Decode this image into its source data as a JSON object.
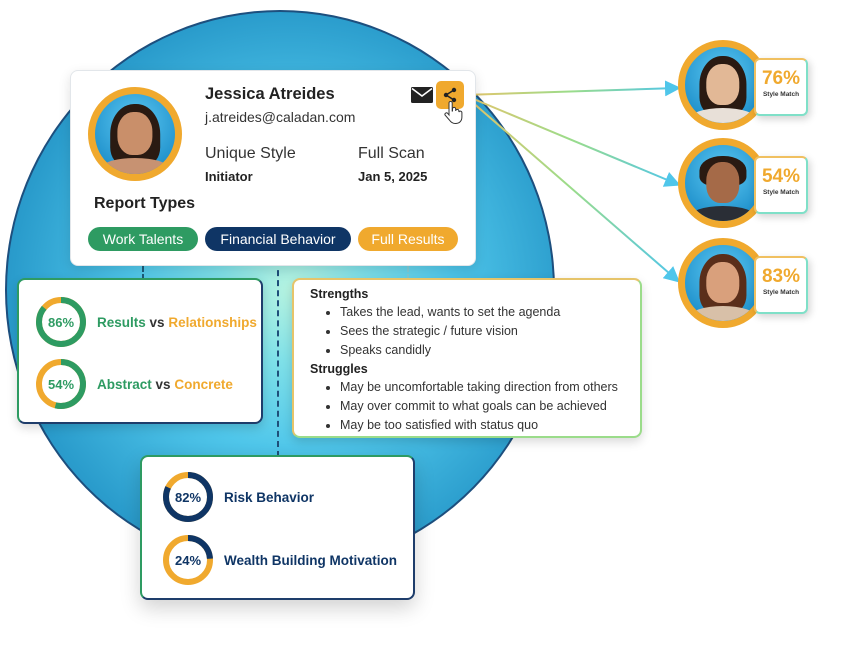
{
  "colors": {
    "green": "#2e9b62",
    "navy": "#0f3565",
    "orange": "#f0a92e",
    "teal": "#4fc6ea"
  },
  "profile": {
    "name": "Jessica Atreides",
    "email": "j.atreides@caladan.com",
    "unique_style_label": "Unique Style",
    "unique_style_value": "Initiator",
    "full_scan_label": "Full Scan",
    "full_scan_value": "Jan 5, 2025",
    "report_types_label": "Report Types",
    "icons": {
      "mail": "envelope-icon",
      "share": "share-icon",
      "cursor": "hand-pointer-icon"
    },
    "report_types": [
      {
        "label": "Work Talents",
        "color": "#2e9b62"
      },
      {
        "label": "Financial Behavior",
        "color": "#0f3565"
      },
      {
        "label": "Full Results",
        "color": "#f0a92e"
      }
    ]
  },
  "work_talents": {
    "rows": [
      {
        "percent": 86,
        "pct_label": "86%",
        "left": "Results",
        "vs": "vs",
        "right": "Relationships"
      },
      {
        "percent": 54,
        "pct_label": "54%",
        "left": "Abstract",
        "vs": "vs",
        "right": "Concrete"
      }
    ]
  },
  "full_results": {
    "strengths_title": "Strengths",
    "strengths": [
      "Takes the lead, wants to set the agenda",
      "Sees the strategic / future vision",
      "Speaks candidly"
    ],
    "struggles_title": "Struggles",
    "struggles": [
      "May be uncomfortable taking direction from others",
      "May over commit to what goals can be achieved",
      "May be too satisfied with status quo"
    ]
  },
  "financial_behavior": {
    "rows": [
      {
        "percent": 82,
        "pct_label": "82%",
        "label": "Risk Behavior"
      },
      {
        "percent": 24,
        "pct_label": "24%",
        "label": "Wealth Building Motivation"
      }
    ]
  },
  "style_matches": [
    {
      "percent": 76,
      "pct_label": "76%",
      "label": "Style Match"
    },
    {
      "percent": 54,
      "pct_label": "54%",
      "label": "Style Match"
    },
    {
      "percent": 83,
      "pct_label": "83%",
      "label": "Style Match"
    }
  ]
}
